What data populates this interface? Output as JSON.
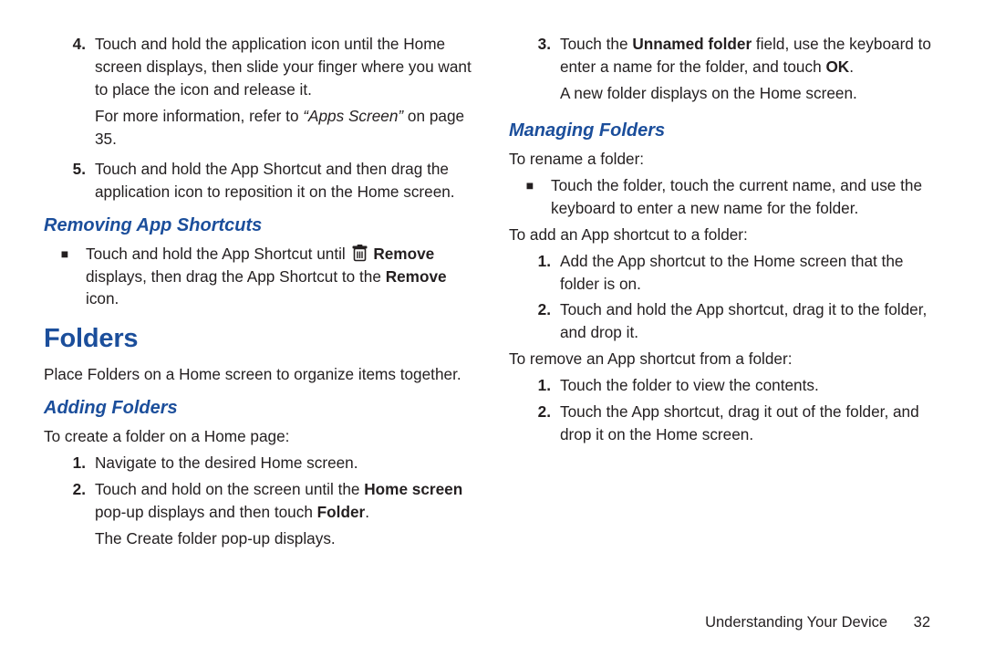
{
  "left": {
    "step4_a": "Touch and hold the application icon until the Home screen displays, then slide your finger where you want to place the icon and release it.",
    "step4_ref_prefix": "For more information, refer to ",
    "step4_ref_em": "“Apps Screen”",
    "step4_ref_suffix": " on page 35.",
    "step5": "Touch and hold the App Shortcut and then drag the application icon to reposition it on the Home screen.",
    "removing_h": "Removing App Shortcuts",
    "removing_b_pre": "Touch and hold the App Shortcut until ",
    "removing_b_remove": "Remove",
    "removing_b_mid": " displays, then drag the App Shortcut to the ",
    "removing_b_remove2": "Remove",
    "removing_b_post": " icon.",
    "folders_h": "Folders",
    "folders_desc": "Place Folders on a Home screen to organize items together.",
    "adding_h": "Adding Folders",
    "adding_intro": "To create a folder on a Home page:",
    "add_s1": "Navigate to the desired Home screen.",
    "add_s2_pre": "Touch and hold on the screen until the ",
    "add_s2_bold": "Home screen",
    "add_s2_mid": " pop-up displays and then touch ",
    "add_s2_bold2": "Folder",
    "add_s2_post": ".",
    "add_s2_note": "The Create folder pop-up displays."
  },
  "right": {
    "step3_pre": "Touch the ",
    "step3_bold1": "Unnamed folder",
    "step3_mid": " field, use the keyboard to enter a name for the folder, and touch ",
    "step3_bold2": "OK",
    "step3_post": ".",
    "step3_note": "A new folder displays on the Home screen.",
    "managing_h": "Managing Folders",
    "rename_intro": "To rename a folder:",
    "rename_b": "Touch the folder, touch the current name, and use the keyboard to enter a new name for the folder.",
    "add_intro": "To add an App shortcut to a folder:",
    "add_s1": "Add the App shortcut to the Home screen that the folder is on.",
    "add_s2": "Touch and hold the App shortcut, drag it to the folder, and drop it.",
    "rem_intro": "To remove an App shortcut from a folder:",
    "rem_s1": "Touch the folder to view the contents.",
    "rem_s2": "Touch the App shortcut, drag it out of the folder, and drop it on the Home screen."
  },
  "footer": {
    "section": "Understanding Your Device",
    "page": "32"
  },
  "nums": {
    "n1": "1.",
    "n2": "2.",
    "n3": "3.",
    "n4": "4.",
    "n5": "5."
  },
  "bullet": "■"
}
